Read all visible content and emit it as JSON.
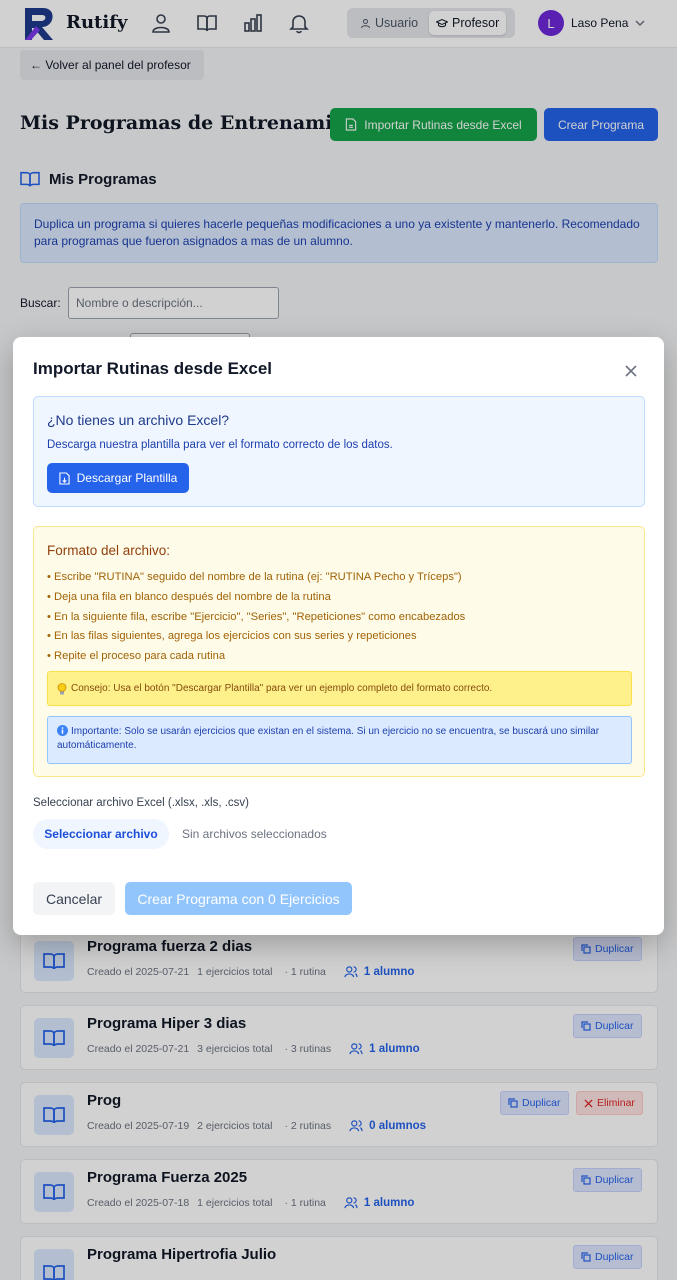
{
  "header": {
    "brand": "Rutify",
    "nav": [
      {
        "icon": "user-icon"
      },
      {
        "icon": "book-icon"
      },
      {
        "icon": "bar-chart-icon"
      },
      {
        "icon": "bell-icon"
      }
    ],
    "roles": [
      {
        "label": "Usuario",
        "active": false,
        "icon": "user-icon"
      },
      {
        "label": "Profesor",
        "active": true,
        "icon": "graduation-cap-icon"
      }
    ],
    "user": {
      "initial": "L",
      "name": "Laso Pena"
    }
  },
  "page": {
    "back_label": "← Volver al panel del profesor",
    "title": "Mis Programas de Entrenamiento",
    "import_label": "Importar Rutinas desde Excel",
    "create_label": "Crear Programa",
    "section_title": "Mis Programas",
    "info_text": "Duplica un programa si quieres hacerle pequeñas modificaciones a uno ya existente y mantenerlo. Recomendado para programas que fueron asignados a mas de un alumno.",
    "search_label": "Buscar:",
    "search_placeholder": "Nombre o descripción...",
    "programs": [
      {
        "name": "Programa fuerza 2 dias",
        "created": "Creado el 2025-07-21",
        "exercises": "1 ejercicios total",
        "routines": "· 1 rutina",
        "students": "1 alumno",
        "duplicate": "Duplicar"
      },
      {
        "name": "Programa Hiper 3 dias",
        "created": "Creado el 2025-07-21",
        "exercises": "3 ejercicios total",
        "routines": "· 3 rutinas",
        "students": "1 alumno",
        "duplicate": "Duplicar"
      },
      {
        "name": "Prog",
        "created": "Creado el 2025-07-19",
        "exercises": "2 ejercicios total",
        "routines": "· 2 rutinas",
        "students": "0 alumnos",
        "duplicate": "Duplicar",
        "delete": "Eliminar"
      },
      {
        "name": "Programa Fuerza 2025",
        "created": "Creado el 2025-07-18",
        "exercises": "1 ejercicios total",
        "routines": "· 1 rutina",
        "students": "1 alumno",
        "duplicate": "Duplicar"
      },
      {
        "name": "Programa Hipertrofia Julio",
        "duplicate": "Duplicar"
      }
    ]
  },
  "modal": {
    "title": "Importar Rutinas desde Excel",
    "download": {
      "title": "¿No tienes un archivo Excel?",
      "desc": "Descarga nuestra plantilla para ver el formato correcto de los datos.",
      "button": "Descargar Plantilla"
    },
    "format": {
      "title": "Formato del archivo:",
      "items": [
        "Escribe \"RUTINA\" seguido del nombre de la rutina (ej: \"RUTINA Pecho y Tríceps\")",
        "Deja una fila en blanco después del nombre de la rutina",
        "En la siguiente fila, escribe \"Ejercicio\", \"Series\", \"Repeticiones\" como encabezados",
        "En las filas siguientes, agrega los ejercicios con sus series y repeticiones",
        "Repite el proceso para cada rutina"
      ],
      "tip": "Consejo: Usa el botón \"Descargar Plantilla\" para ver un ejemplo completo del formato correcto.",
      "important": "Importante: Solo se usarán ejercicios que existan en el sistema. Si un ejercicio no se encuentra, se buscará uno similar automáticamente."
    },
    "file_label": "Seleccionar archivo Excel (.xlsx, .xls, .csv)",
    "file_button": "Seleccionar archivo",
    "file_status": "Sin archivos seleccionados",
    "cancel": "Cancelar",
    "submit": "Crear Programa con 0 Ejercicios"
  },
  "colors": {
    "primary": "#2563eb",
    "success": "#16a34a",
    "danger": "#dc2626",
    "avatar": "#6d28d9"
  }
}
